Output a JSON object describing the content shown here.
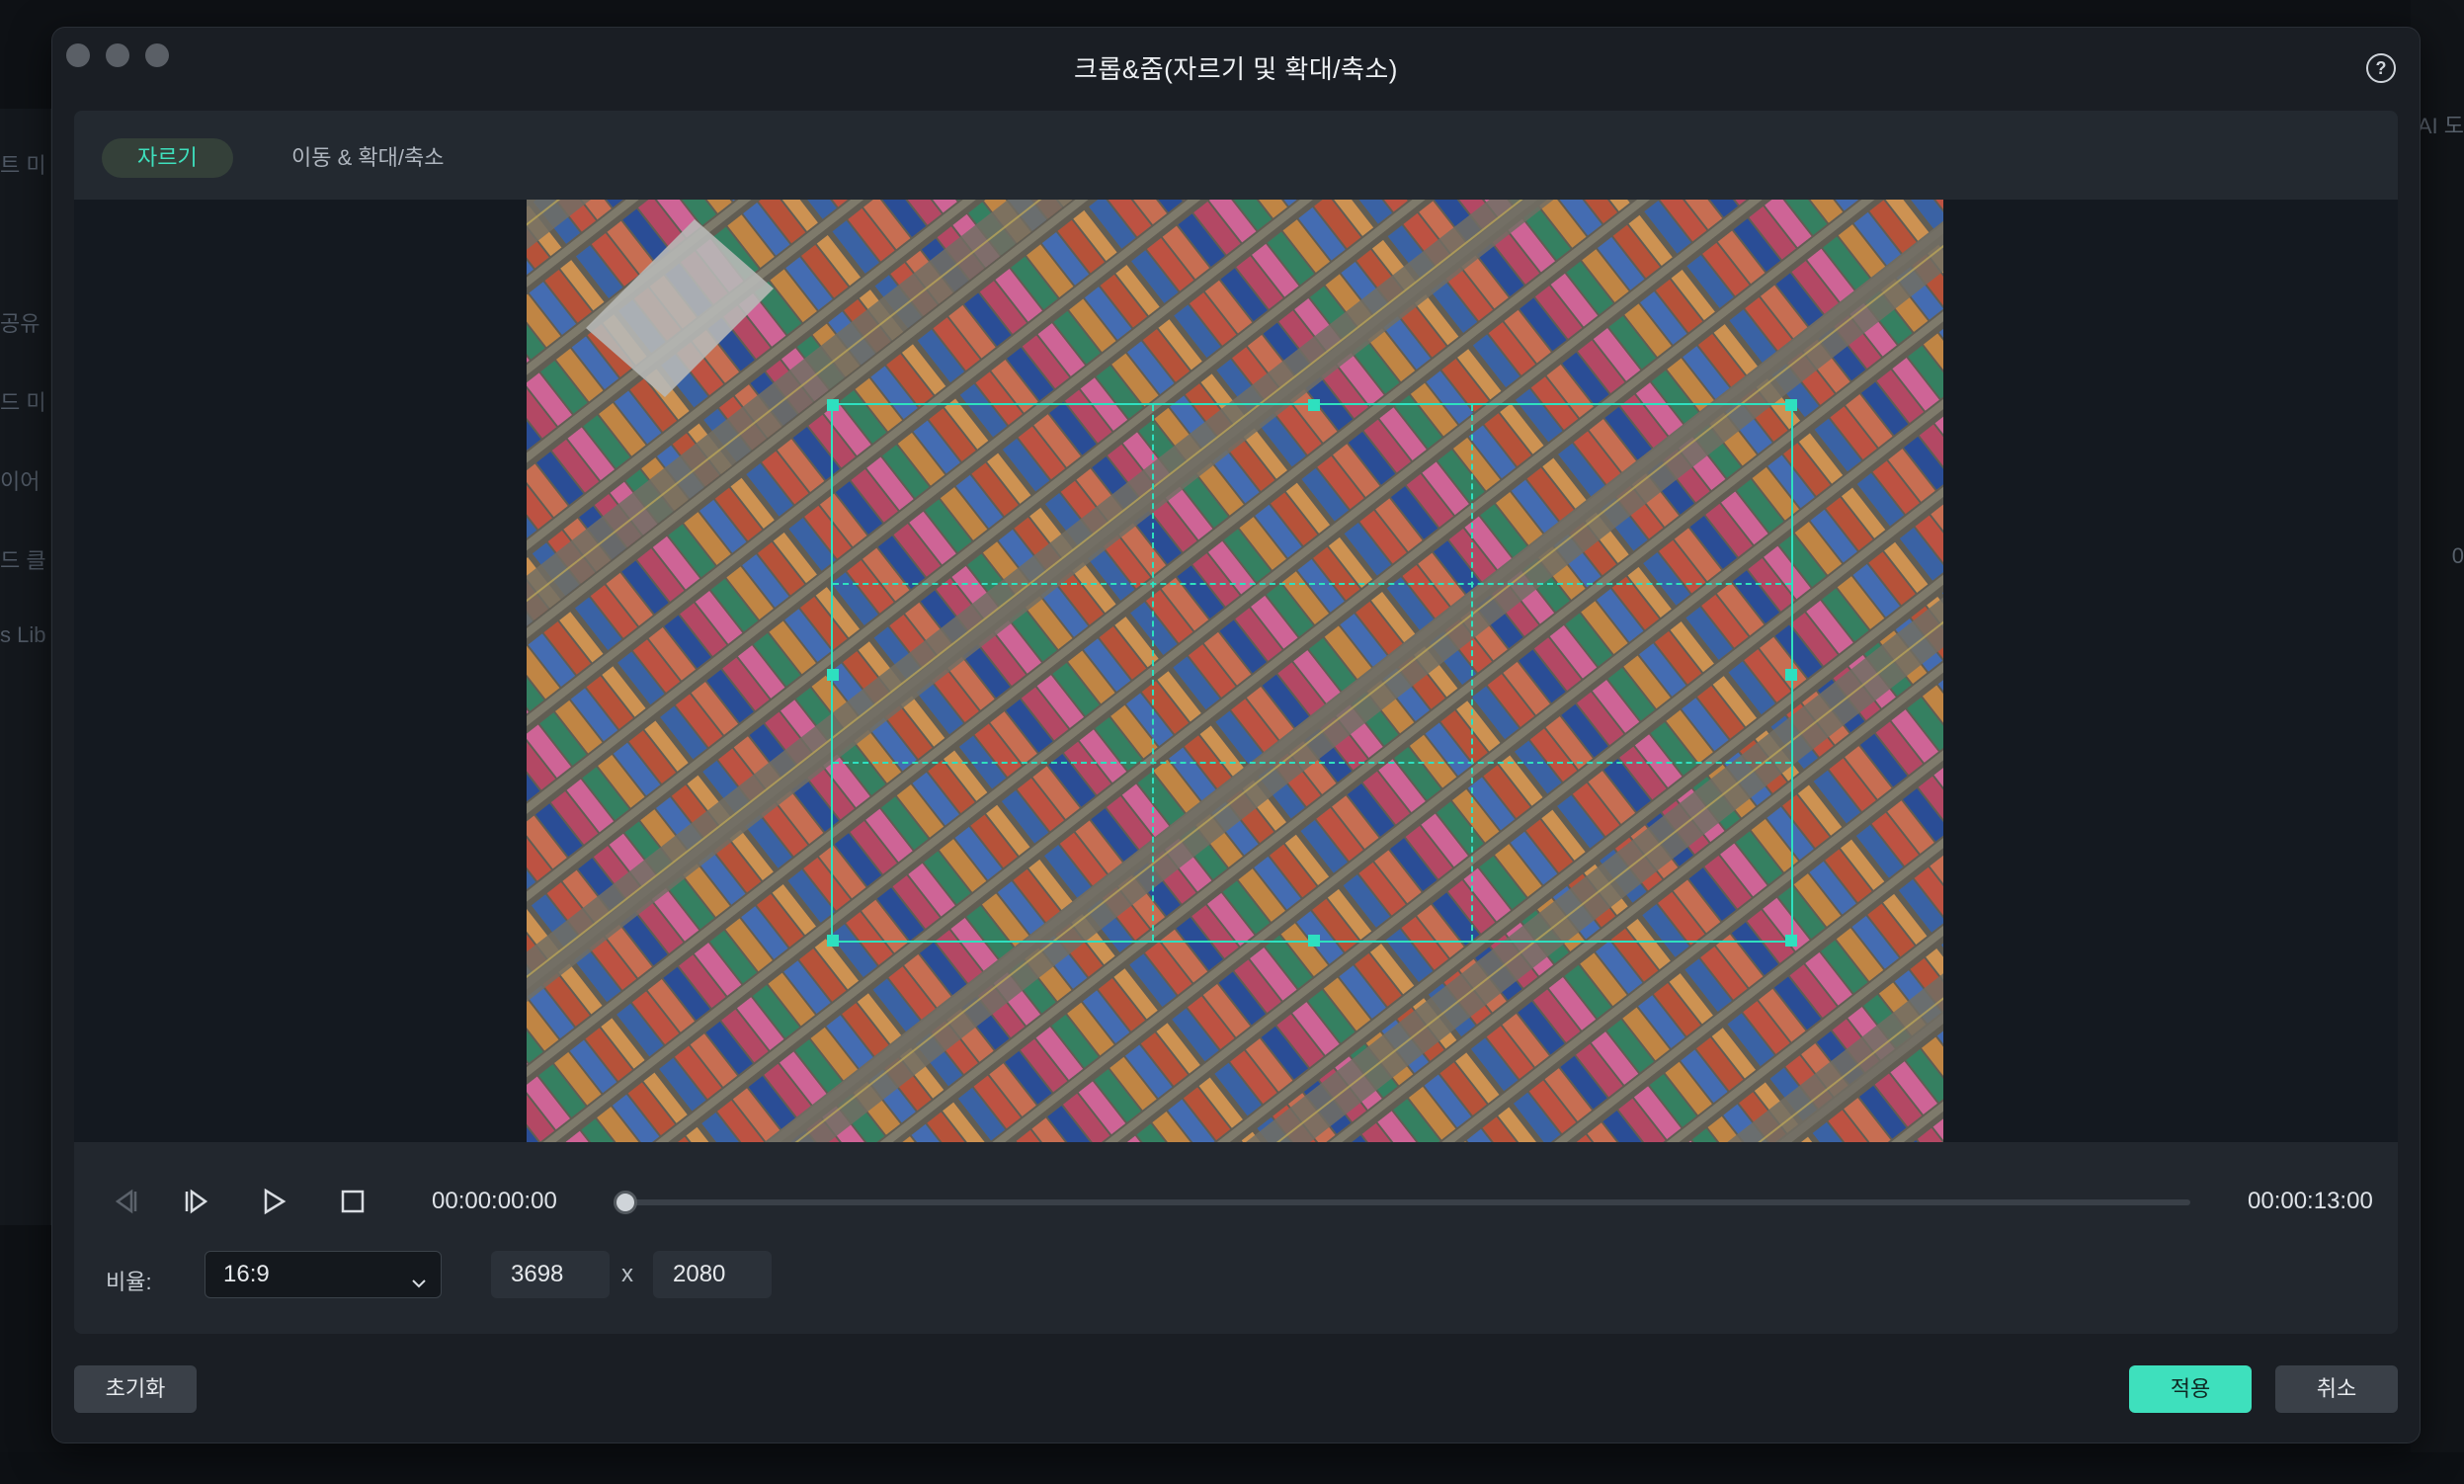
{
  "background": {
    "left_items": [
      "트 미",
      "",
      "공유",
      "드 미",
      "이어",
      "드 클",
      "s Lib"
    ],
    "right_items": [
      "AI 도",
      "0"
    ]
  },
  "dialog": {
    "title": "크롭&줌(자르기 및 확대/축소)",
    "help_icon": "?",
    "tabs": [
      {
        "label": "자르기",
        "active": true
      },
      {
        "label": "이동 & 확대/축소",
        "active": false
      }
    ]
  },
  "playback": {
    "current_time": "00:00:00:00",
    "total_time": "00:00:13:00",
    "progress": 0
  },
  "crop": {
    "ratio_label": "비율:",
    "ratio_value": "16:9",
    "width": "3698",
    "separator": "x",
    "height": "2080"
  },
  "buttons": {
    "reset": "초기화",
    "apply": "적용",
    "cancel": "취소"
  },
  "colors": {
    "accent": "#3ee0bd",
    "crop_frame": "#2ee0bf",
    "dialog_bg": "#1a1e24"
  }
}
